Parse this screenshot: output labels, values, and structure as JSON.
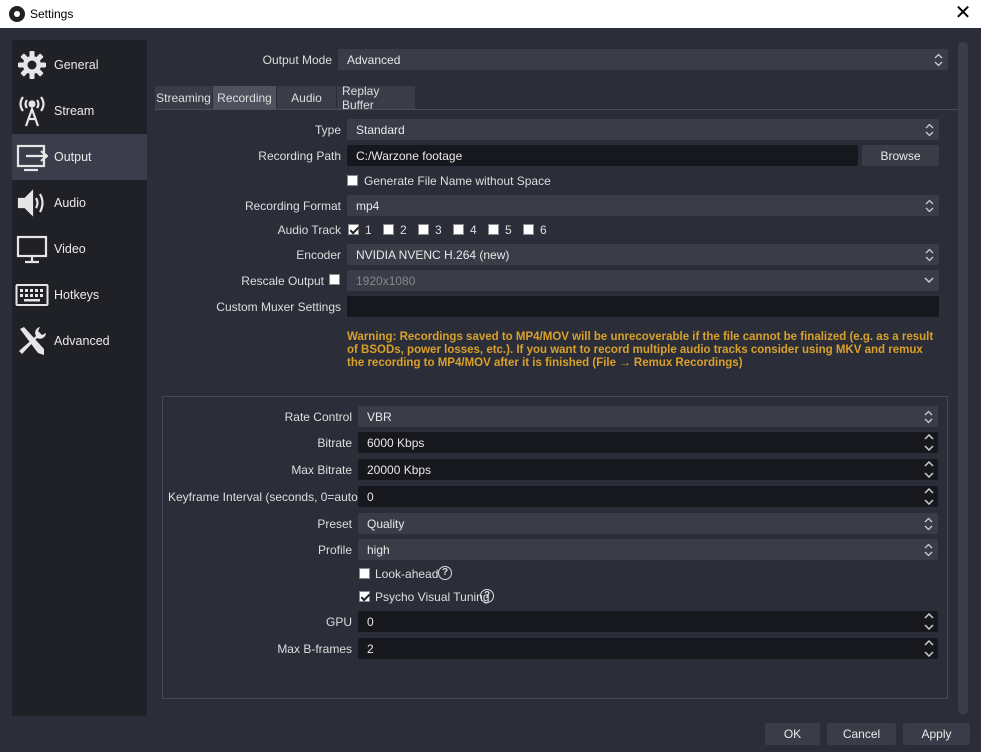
{
  "window": {
    "title": "Settings"
  },
  "sidebar": {
    "items": [
      {
        "label": "General",
        "icon": "gear-icon"
      },
      {
        "label": "Stream",
        "icon": "broadcast-icon"
      },
      {
        "label": "Output",
        "icon": "output-icon"
      },
      {
        "label": "Audio",
        "icon": "speaker-icon"
      },
      {
        "label": "Video",
        "icon": "monitor-icon"
      },
      {
        "label": "Hotkeys",
        "icon": "keyboard-icon"
      },
      {
        "label": "Advanced",
        "icon": "tools-icon"
      }
    ],
    "active": "Output"
  },
  "output_mode": {
    "label": "Output Mode",
    "value": "Advanced"
  },
  "tabs": [
    "Streaming",
    "Recording",
    "Audio",
    "Replay Buffer"
  ],
  "recording": {
    "type": {
      "label": "Type",
      "value": "Standard"
    },
    "path": {
      "label": "Recording Path",
      "value": "C:/Warzone footage",
      "browse": "Browse"
    },
    "gen_filename": {
      "label": "Generate File Name without Space",
      "checked": false
    },
    "format": {
      "label": "Recording Format",
      "value": "mp4"
    },
    "audio_track": {
      "label": "Audio Track",
      "tracks": [
        {
          "label": "1",
          "checked": true
        },
        {
          "label": "2",
          "checked": false
        },
        {
          "label": "3",
          "checked": false
        },
        {
          "label": "4",
          "checked": false
        },
        {
          "label": "5",
          "checked": false
        },
        {
          "label": "6",
          "checked": false
        }
      ]
    },
    "encoder": {
      "label": "Encoder",
      "value": "NVIDIA NVENC H.264 (new)"
    },
    "rescale": {
      "label": "Rescale Output",
      "checked": false,
      "value": "1920x1080"
    },
    "muxer": {
      "label": "Custom Muxer Settings",
      "value": ""
    },
    "warning": "Warning: Recordings saved to MP4/MOV will be unrecoverable if the file cannot be finalized (e.g. as a result of BSODs, power losses, etc.). If you want to record multiple audio tracks consider using MKV and remux the recording to MP4/MOV after it is finished (File → Remux Recordings)"
  },
  "encoder_settings": {
    "rate_control": {
      "label": "Rate Control",
      "value": "VBR"
    },
    "bitrate": {
      "label": "Bitrate",
      "value": "6000 Kbps"
    },
    "max_bitrate": {
      "label": "Max Bitrate",
      "value": "20000 Kbps"
    },
    "keyframe": {
      "label": "Keyframe Interval (seconds, 0=auto)",
      "value": "0"
    },
    "preset": {
      "label": "Preset",
      "value": "Quality"
    },
    "profile": {
      "label": "Profile",
      "value": "high"
    },
    "lookahead": {
      "label": "Look-ahead",
      "checked": false
    },
    "psycho": {
      "label": "Psycho Visual Tuning",
      "checked": true
    },
    "gpu": {
      "label": "GPU",
      "value": "0"
    },
    "bframes": {
      "label": "Max B-frames",
      "value": "2"
    }
  },
  "buttons": {
    "ok": "OK",
    "cancel": "Cancel",
    "apply": "Apply"
  },
  "colors": {
    "background": "#2b2e38",
    "sidebar": "#1f2127",
    "warning": "#d9a02b"
  }
}
